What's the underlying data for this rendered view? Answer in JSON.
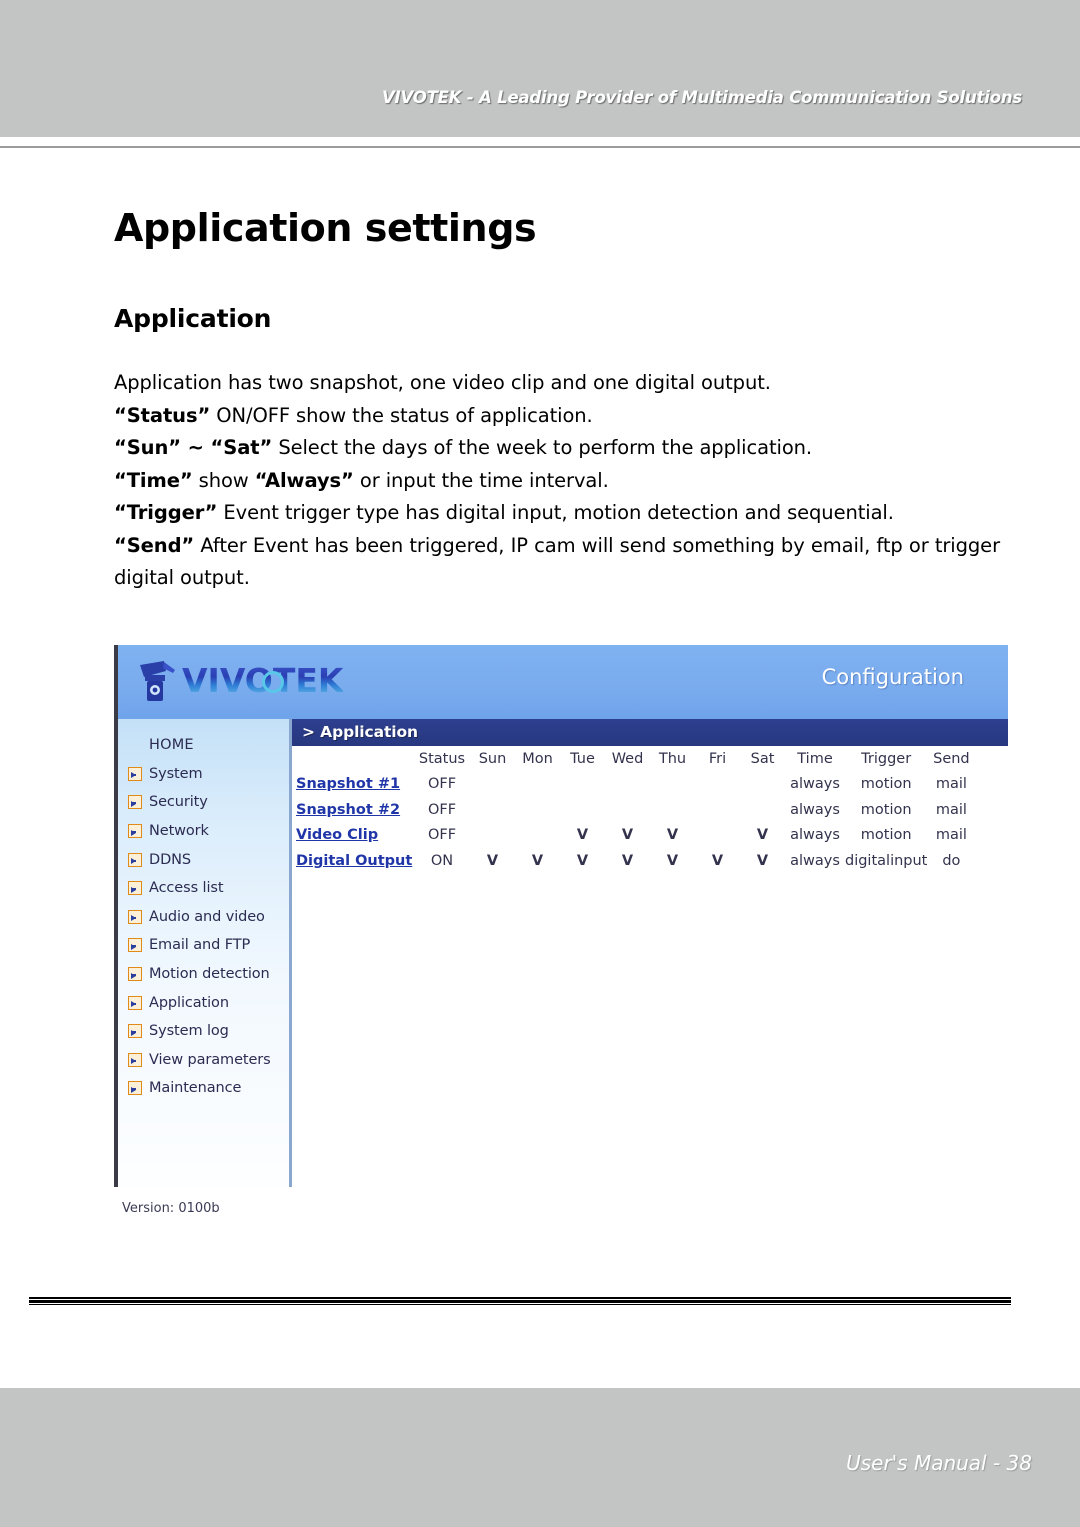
{
  "header": {
    "banner_text": "VIVOTEK - A Leading Provider of Multimedia Communication Solutions"
  },
  "page": {
    "title": "Application settings",
    "section_title": "Application",
    "paragraphs": {
      "intro": "Application has two snapshot, one video clip and one digital output.",
      "status_term": "“Status”",
      "status_rest": " ON/OFF show the status of application.",
      "sun_term": "“Sun” ~ “Sat”",
      "sun_rest": " Select the days of the week to perform the application.",
      "time_term": "“Time”",
      "time_mid": " show ",
      "time_term2": "“Always”",
      "time_rest": " or input the time interval.",
      "trigger_term": "“Trigger”",
      "trigger_rest": " Event trigger type has digital input, motion detection and sequential.",
      "send_term": "“Send”",
      "send_rest": " After Event has been triggered, IP cam will send something by email, ftp or trigger digital output."
    }
  },
  "screenshot": {
    "logo_text": "VIVOTEK",
    "config_label": "Configuration",
    "breadcrumb": "> Application",
    "version": "Version: 0100b",
    "sidebar": {
      "items": [
        {
          "label": "HOME",
          "has_icon": false
        },
        {
          "label": "System",
          "has_icon": true
        },
        {
          "label": "Security",
          "has_icon": true
        },
        {
          "label": "Network",
          "has_icon": true
        },
        {
          "label": "DDNS",
          "has_icon": true
        },
        {
          "label": "Access list",
          "has_icon": true
        },
        {
          "label": "Audio and video",
          "has_icon": true
        },
        {
          "label": "Email and FTP",
          "has_icon": true
        },
        {
          "label": "Motion detection",
          "has_icon": true
        },
        {
          "label": "Application",
          "has_icon": true
        },
        {
          "label": "System log",
          "has_icon": true
        },
        {
          "label": "View parameters",
          "has_icon": true
        },
        {
          "label": "Maintenance",
          "has_icon": true
        }
      ]
    },
    "table": {
      "columns": [
        "",
        "Status",
        "Sun",
        "Mon",
        "Tue",
        "Wed",
        "Thu",
        "Fri",
        "Sat",
        "Time",
        "Trigger",
        "Send"
      ],
      "check_mark": "V",
      "rows": [
        {
          "name": "Snapshot #1",
          "status": "OFF",
          "days": [
            "",
            "",
            "",
            "",
            "",
            "",
            ""
          ],
          "time": "always",
          "trigger": "motion",
          "send": "mail"
        },
        {
          "name": "Snapshot #2",
          "status": "OFF",
          "days": [
            "",
            "",
            "",
            "",
            "",
            "",
            ""
          ],
          "time": "always",
          "trigger": "motion",
          "send": "mail"
        },
        {
          "name": "Video Clip",
          "status": "OFF",
          "days": [
            "",
            "",
            "V",
            "V",
            "V",
            "",
            "V"
          ],
          "time": "always",
          "trigger": "motion",
          "send": "mail"
        },
        {
          "name": "Digital Output",
          "status": "ON",
          "days": [
            "V",
            "V",
            "V",
            "V",
            "V",
            "V",
            "V"
          ],
          "time": "always",
          "trigger": "digitalinput",
          "send": "do"
        }
      ]
    }
  },
  "footer": {
    "text": "User's Manual - 38"
  },
  "colors": {
    "band_gray": "#c3c4c4",
    "header_blue": "#79abee",
    "breadcrumb_navy": "#2d3f8f",
    "link_blue": "#2036a8",
    "icon_orange": "#e08a19"
  }
}
